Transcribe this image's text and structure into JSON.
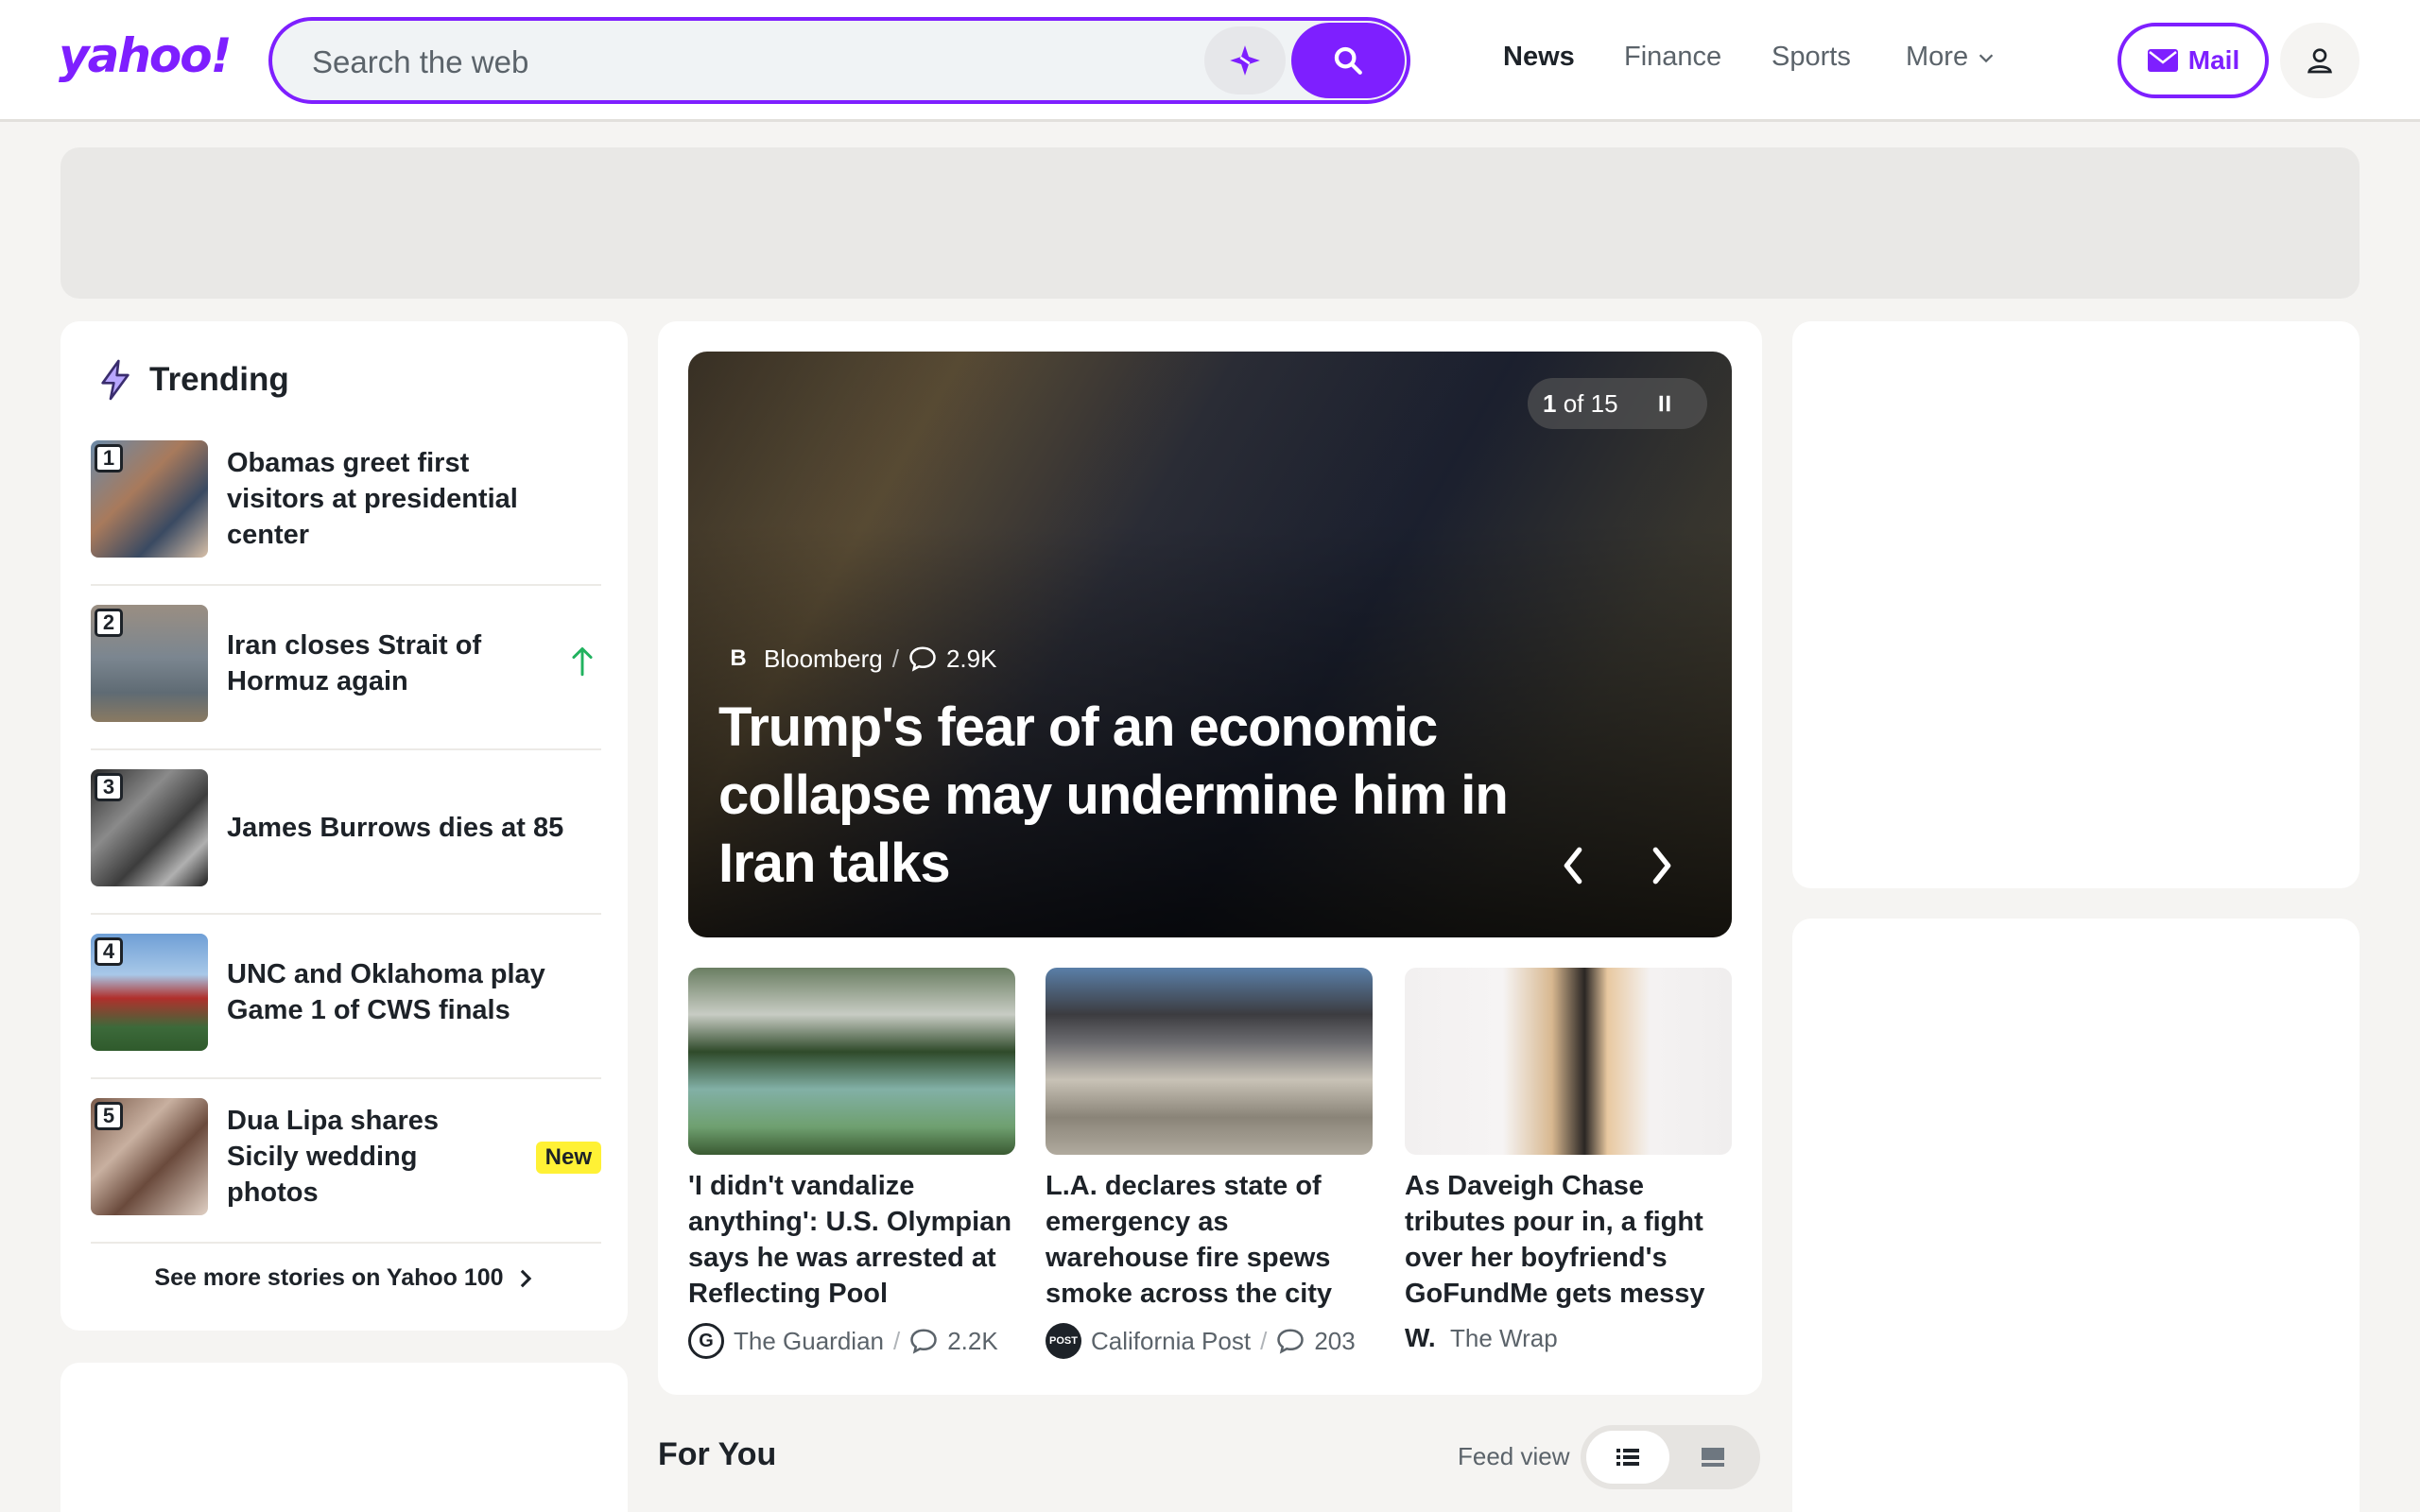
{
  "header": {
    "logo": "yahoo!",
    "search_placeholder": "Search the web",
    "nav": [
      "News",
      "Finance",
      "Sports",
      "More"
    ],
    "mail_label": "Mail"
  },
  "trending": {
    "title": "Trending",
    "items": [
      {
        "rank": "1",
        "text": "Obamas greet first visitors at presidential center"
      },
      {
        "rank": "2",
        "text": "Iran closes Strait of Hormuz again"
      },
      {
        "rank": "3",
        "text": "James Burrows dies at 85"
      },
      {
        "rank": "4",
        "text": "UNC and Oklahoma play Game 1 of CWS finals"
      },
      {
        "rank": "5",
        "text": "Dua Lipa shares Sicily wedding photos",
        "badge": "New"
      }
    ],
    "see_more": "See more stories on Yahoo 100"
  },
  "hero": {
    "pager_current": "1",
    "pager_text": "of 15",
    "source_logo": "B",
    "source": "Bloomberg",
    "comments": "2.9K",
    "title": "Trump's fear of an economic collapse may undermine him in Iran talks"
  },
  "stories": [
    {
      "title": "'I didn't vandalize anything': U.S. Olympian says he was arrested at Reflecting Pool",
      "source": "The Guardian",
      "source_logo": "G",
      "comments": "2.2K"
    },
    {
      "title": "L.A. declares state of emergency as warehouse fire spews smoke across the city",
      "source": "California Post",
      "source_logo": "POST",
      "comments": "203"
    },
    {
      "title": "As Daveigh Chase tributes pour in, a fight over her boyfriend's GoFundMe gets messy",
      "source": "The Wrap",
      "source_logo": "W."
    }
  ],
  "for_you": {
    "title": "For You",
    "feed_view_label": "Feed view"
  },
  "colors": {
    "brand": "#7e1fff",
    "trend_up": "#21b25f",
    "badge_new": "#fff135"
  }
}
